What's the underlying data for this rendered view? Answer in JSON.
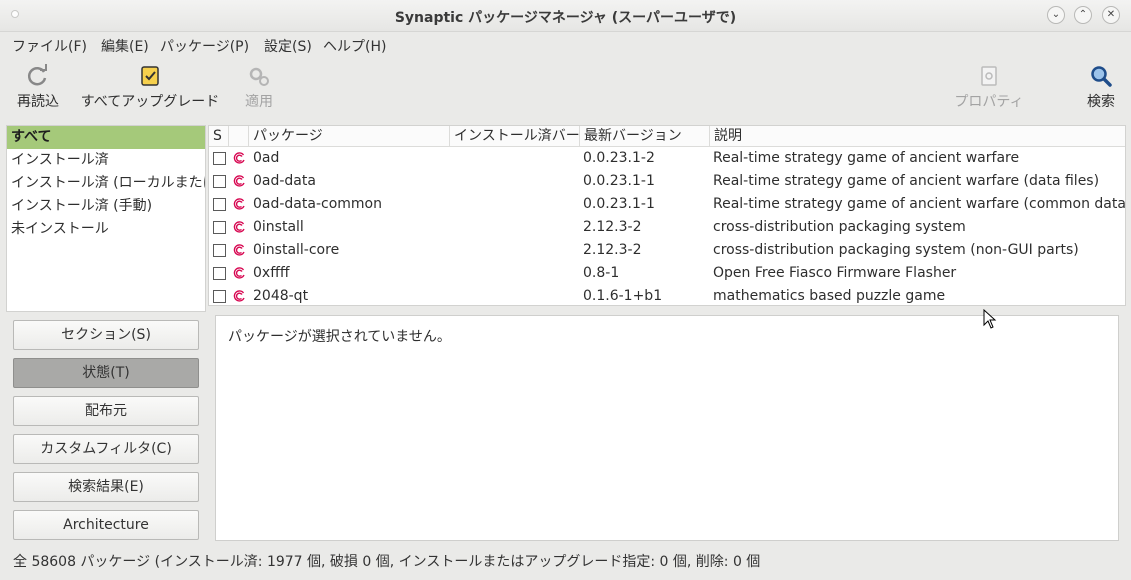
{
  "window": {
    "title": "Synaptic パッケージマネージャ (スーパーユーザで)",
    "controls": [
      "⌄",
      "⌃",
      "✕"
    ]
  },
  "menu": [
    "ファイル(F)",
    "編集(E)",
    "パッケージ(P)",
    "設定(S)",
    "ヘルプ(H)"
  ],
  "toolbar": {
    "reload": "再読込",
    "upgrade_all": "すべてアップグレード",
    "apply": "適用",
    "properties": "プロパティ",
    "search": "検索"
  },
  "filters": [
    "すべて",
    "インストール済",
    "インストール済 (ローカルまたは古い)",
    "インストール済 (手動)",
    "未インストール"
  ],
  "table": {
    "headers": [
      "S",
      "",
      "パッケージ",
      "インストール済バージョン",
      "最新バージョン",
      "説明"
    ],
    "rows": [
      {
        "name": "0ad",
        "installed": "",
        "latest": "0.0.23.1-2",
        "desc": "Real-time strategy game of ancient warfare"
      },
      {
        "name": "0ad-data",
        "installed": "",
        "latest": "0.0.23.1-1",
        "desc": "Real-time strategy game of ancient warfare (data files)"
      },
      {
        "name": "0ad-data-common",
        "installed": "",
        "latest": "0.0.23.1-1",
        "desc": "Real-time strategy game of ancient warfare (common data files)"
      },
      {
        "name": "0install",
        "installed": "",
        "latest": "2.12.3-2",
        "desc": "cross-distribution packaging system"
      },
      {
        "name": "0install-core",
        "installed": "",
        "latest": "2.12.3-2",
        "desc": "cross-distribution packaging system (non-GUI parts)"
      },
      {
        "name": "0xffff",
        "installed": "",
        "latest": "0.8-1",
        "desc": "Open Free Fiasco Firmware Flasher"
      },
      {
        "name": "2048-qt",
        "installed": "",
        "latest": "0.1.6-1+b1",
        "desc": "mathematics based puzzle game"
      }
    ]
  },
  "side_buttons": [
    "セクション(S)",
    "状態(T)",
    "配布元",
    "カスタムフィルタ(C)",
    "検索結果(E)",
    "Architecture"
  ],
  "description": "パッケージが選択されていません。",
  "status": "全 58608 パッケージ (インストール済: 1977 個, 破損 0 個, インストールまたはアップグレード指定: 0 個, 削除: 0 個",
  "colors": {
    "selection": "#a5c97a",
    "debian_swirl": "#d70751"
  }
}
